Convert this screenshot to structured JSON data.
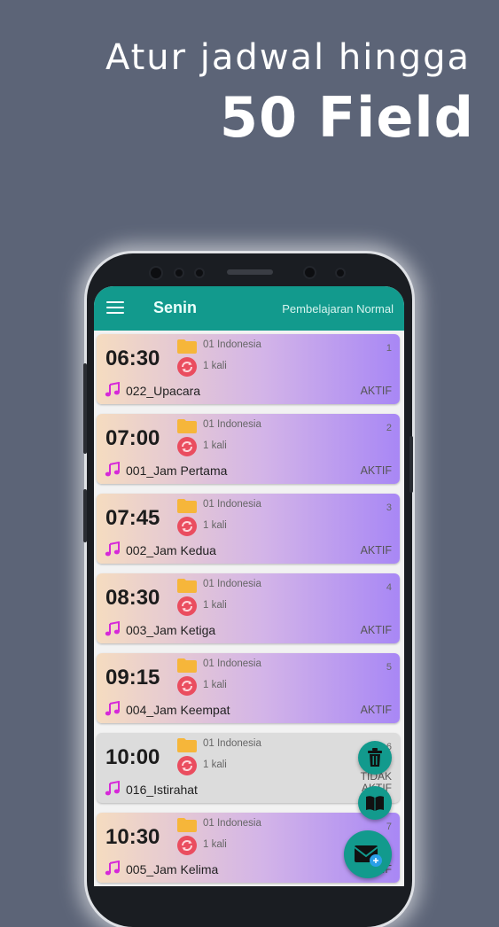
{
  "promo": {
    "line1": "Atur jadwal hingga",
    "line2": "50 Field"
  },
  "appbar": {
    "day": "Senin",
    "mode": "Pembelajaran Normal"
  },
  "colors": {
    "teal": "#129a8d",
    "folder": "#f6b63a",
    "repeat": "#ea4d5f",
    "music": "#d629d9"
  },
  "schedule": [
    {
      "no": "1",
      "time": "06:30",
      "group": "01 Indonesia",
      "repeat": "1 kali",
      "song": "022_Upacara",
      "status": "AKTIF"
    },
    {
      "no": "2",
      "time": "07:00",
      "group": "01 Indonesia",
      "repeat": "1 kali",
      "song": "001_Jam Pertama",
      "status": "AKTIF"
    },
    {
      "no": "3",
      "time": "07:45",
      "group": "01 Indonesia",
      "repeat": "1 kali",
      "song": "002_Jam Kedua",
      "status": "AKTIF"
    },
    {
      "no": "4",
      "time": "08:30",
      "group": "01 Indonesia",
      "repeat": "1 kali",
      "song": "003_Jam Ketiga",
      "status": "AKTIF"
    },
    {
      "no": "5",
      "time": "09:15",
      "group": "01 Indonesia",
      "repeat": "1 kali",
      "song": "004_Jam Keempat",
      "status": "AKTIF"
    },
    {
      "no": "6",
      "time": "10:00",
      "group": "01 Indonesia",
      "repeat": "1 kali",
      "song": "016_Istirahat",
      "status_line1": "TIDAK",
      "status_line2": "AKTIF"
    },
    {
      "no": "7",
      "time": "10:30",
      "group": "01 Indonesia",
      "repeat": "1 kali",
      "song": "005_Jam Kelima",
      "status": "AKTIF"
    }
  ],
  "fabs": {
    "delete_icon": "trash-icon",
    "book_icon": "book-icon",
    "mail_icon": "mail-icon"
  }
}
